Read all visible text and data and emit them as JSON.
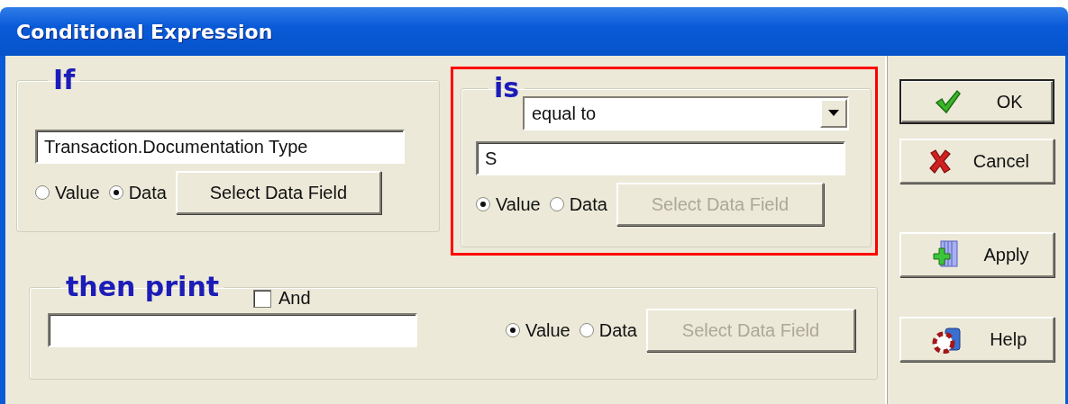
{
  "window": {
    "title": "Conditional Expression"
  },
  "if_group": {
    "label": "If",
    "field_value": "Transaction.Documentation Type",
    "radios": [
      {
        "label": "Value",
        "selected": false
      },
      {
        "label": "Data",
        "selected": true
      }
    ],
    "select_button": {
      "label": "Select Data Field",
      "disabled": false
    }
  },
  "is_group": {
    "label": "is",
    "highlighted": true,
    "operator": "equal to",
    "field_value": "S",
    "radios": [
      {
        "label": "Value",
        "selected": true
      },
      {
        "label": "Data",
        "selected": false
      }
    ],
    "select_button": {
      "label": "Select Data Field",
      "disabled": true
    }
  },
  "then_group": {
    "label": "then print",
    "and_checkbox": {
      "label": "And",
      "checked": false
    },
    "radios": [
      {
        "label": "Value",
        "selected": true
      },
      {
        "label": "Data",
        "selected": false
      }
    ],
    "select_button": {
      "label": "Select Data Field",
      "disabled": true
    }
  },
  "buttons": [
    {
      "kind": "ok",
      "label": "OK",
      "default": true
    },
    {
      "kind": "cancel",
      "label": "Cancel",
      "default": false
    },
    {
      "kind": "apply",
      "label": "Apply",
      "default": false
    },
    {
      "kind": "help",
      "label": "Help",
      "default": false
    }
  ]
}
